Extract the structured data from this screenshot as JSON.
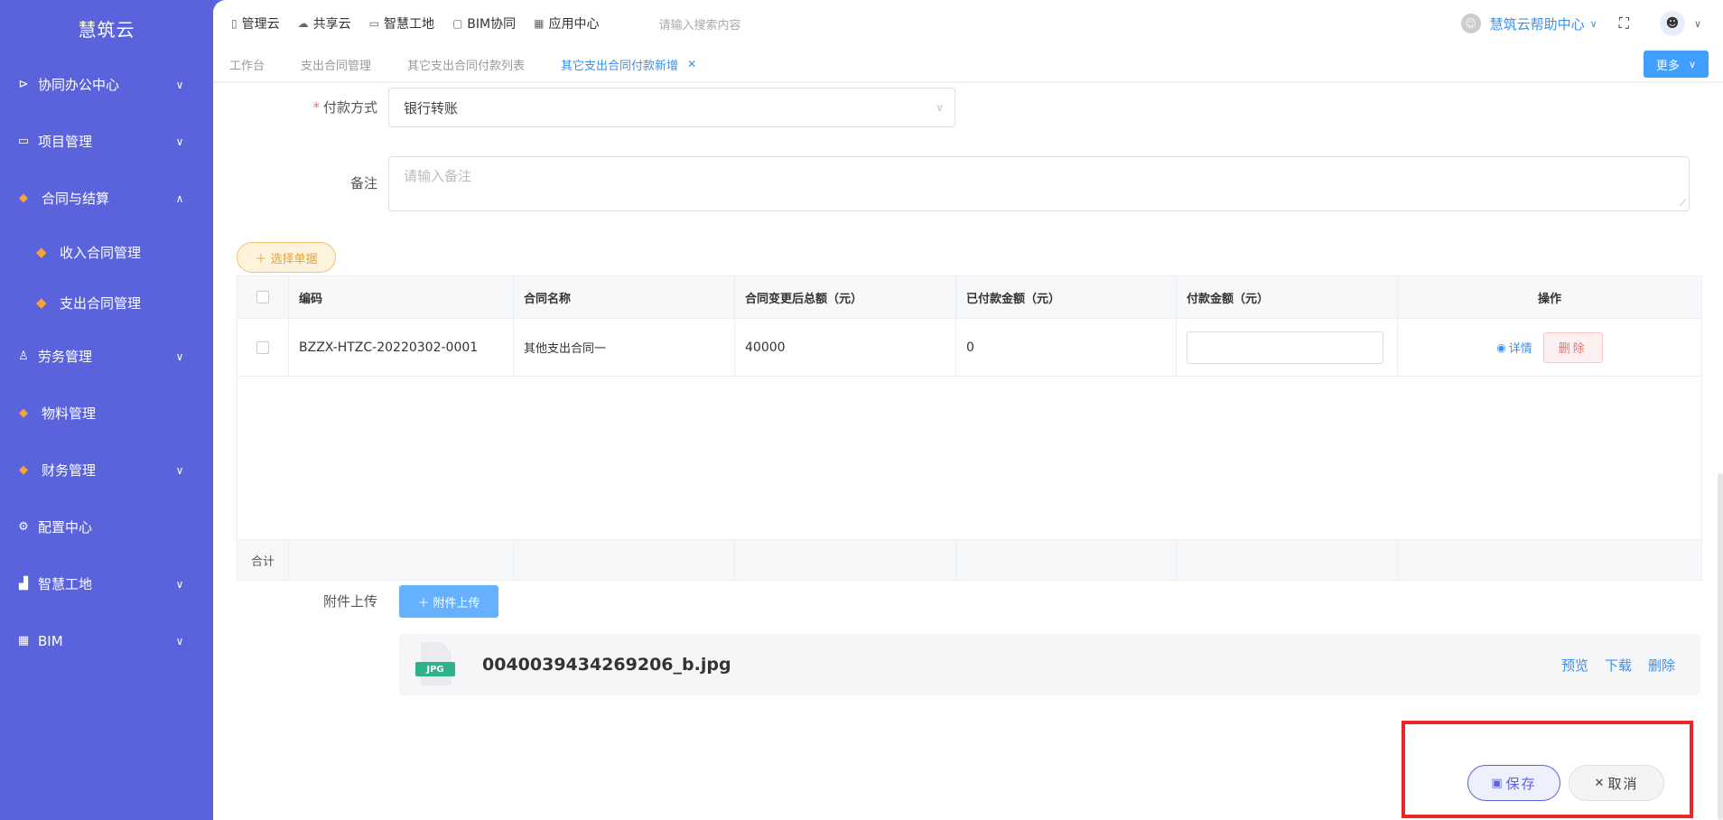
{
  "sidebar": {
    "brand": "慧筑云",
    "items": [
      {
        "label": "协同办公中心",
        "icon": "send-icon",
        "glyph": "⊳",
        "expanded": false
      },
      {
        "label": "项目管理",
        "icon": "book-icon",
        "glyph": "▭",
        "expanded": false
      },
      {
        "label": "合同与结算",
        "icon": "gem-icon",
        "glyph": "◆",
        "expanded": true
      },
      {
        "label": "收入合同管理",
        "icon": "gem-icon",
        "glyph": "◆",
        "sub": true
      },
      {
        "label": "支出合同管理",
        "icon": "gem-icon",
        "glyph": "◆",
        "sub": true
      },
      {
        "label": "劳务管理",
        "icon": "person-icon",
        "glyph": "♙",
        "expanded": false
      },
      {
        "label": "物料管理",
        "icon": "gem-icon",
        "glyph": "◆"
      },
      {
        "label": "财务管理",
        "icon": "gem-icon",
        "glyph": "◆",
        "expanded": false
      },
      {
        "label": "配置中心",
        "icon": "gear-icon",
        "glyph": "⚙"
      },
      {
        "label": "智慧工地",
        "icon": "bar-chart-icon",
        "glyph": "▟",
        "expanded": false
      },
      {
        "label": "BIM",
        "icon": "grid-icon",
        "glyph": "▦",
        "expanded": false
      }
    ]
  },
  "topbar": {
    "links": [
      {
        "label": "管理云",
        "icon": "phone-icon",
        "glyph": "▯"
      },
      {
        "label": "共享云",
        "icon": "cloud-icon",
        "glyph": "☁"
      },
      {
        "label": "智慧工地",
        "icon": "book-icon",
        "glyph": "▭"
      },
      {
        "label": "BIM协同",
        "icon": "folder-icon",
        "glyph": "▢"
      },
      {
        "label": "应用中心",
        "icon": "grid-icon",
        "glyph": "▦"
      }
    ],
    "search_placeholder": "请输入搜索内容",
    "help_center": "慧筑云帮助中心"
  },
  "tabs": {
    "items": [
      "工作台",
      "支出合同管理",
      "其它支出合同付款列表"
    ],
    "active": "其它支出合同付款新增",
    "more": "更多"
  },
  "form": {
    "payment_method_label": "付款方式",
    "payment_method_value": "银行转账",
    "remark_label": "备注",
    "remark_placeholder": "请输入备注",
    "pick_button": "选择单据"
  },
  "table": {
    "headers": [
      "编码",
      "合同名称",
      "合同变更后总额（元）",
      "已付款金额（元）",
      "付款金额（元）",
      "操作"
    ],
    "row": {
      "code": "BZZX-HTZC-20220302-0001",
      "name": "其他支出合同一",
      "total": "40000",
      "paid": "0",
      "detail": "详情",
      "delete": "删除"
    },
    "footer_label": "合计"
  },
  "attachment": {
    "label": "附件上传",
    "button": "附件上传",
    "file_badge": "JPG",
    "file_name": "0040039434269206_b.jpg",
    "actions": [
      "预览",
      "下载",
      "删除"
    ]
  },
  "actions": {
    "save": "保存",
    "cancel": "取消"
  },
  "colors": {
    "sidebar": "#5b63dc",
    "primary": "#409eff",
    "danger": "#f56c6c",
    "warning": "#e6a23c",
    "highlight": "#e8282b"
  }
}
